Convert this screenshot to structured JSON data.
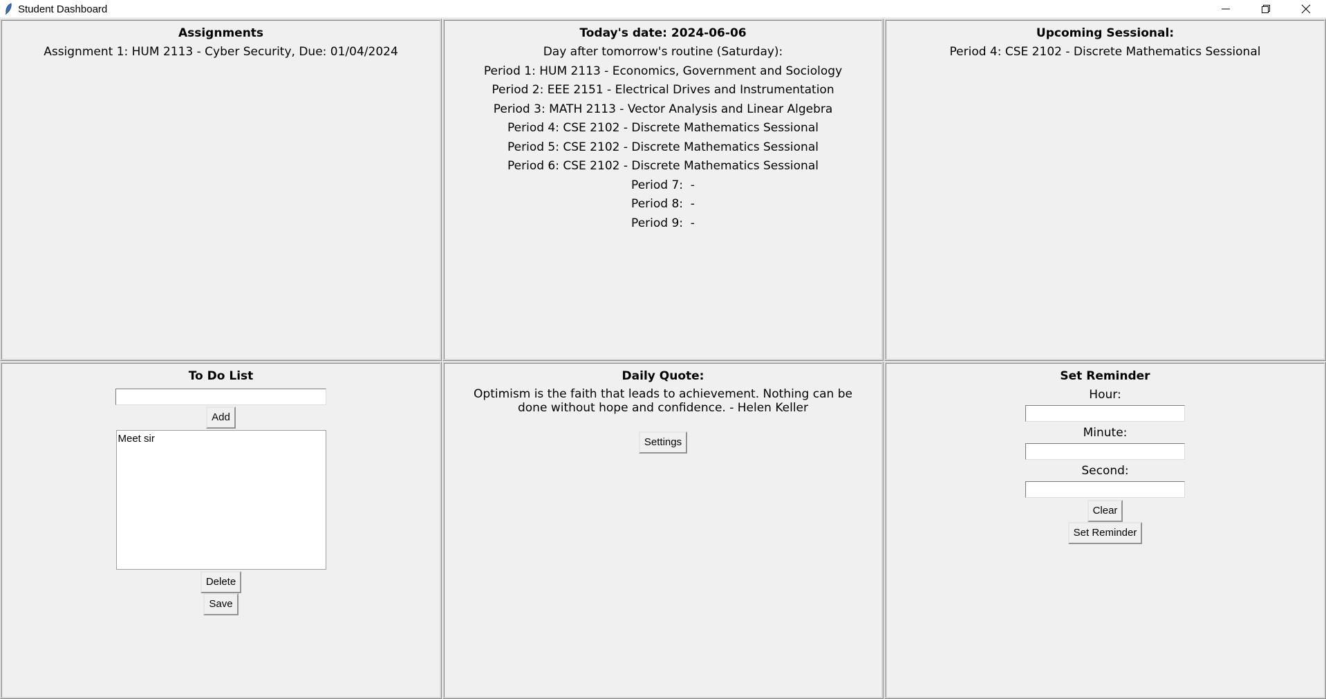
{
  "window": {
    "title": "Student Dashboard"
  },
  "assignments": {
    "heading": "Assignments",
    "items": [
      "Assignment 1: HUM 2113 - Cyber Security, Due: 01/04/2024"
    ]
  },
  "today": {
    "heading": "Today's date: 2024-06-06",
    "routine_label": "Day after tomorrow's routine (Saturday):",
    "periods": [
      "Period 1: HUM 2113 - Economics, Government and Sociology",
      "Period 2: EEE 2151 - Electrical Drives and Instrumentation",
      "Period 3: MATH 2113 - Vector Analysis and Linear Algebra",
      "Period 4: CSE 2102 - Discrete Mathematics Sessional",
      "Period 5: CSE 2102 - Discrete Mathematics Sessional",
      "Period 6: CSE 2102 - Discrete Mathematics Sessional",
      "Period 7:  -",
      "Period 8:  -",
      "Period 9:  -"
    ]
  },
  "upcoming": {
    "heading": "Upcoming Sessional:",
    "items": [
      "Period 4: CSE 2102 - Discrete Mathematics Sessional"
    ]
  },
  "todo": {
    "heading": "To Do List",
    "input_value": "",
    "add_label": "Add",
    "items": [
      "Meet sir"
    ],
    "delete_label": "Delete",
    "save_label": "Save"
  },
  "quote": {
    "heading": "Daily Quote:",
    "text": "Optimism is the faith that leads to achievement. Nothing can be done without hope and confidence. - Helen Keller",
    "settings_label": "Settings"
  },
  "reminder": {
    "heading": "Set Reminder",
    "hour_label": "Hour:",
    "minute_label": "Minute:",
    "second_label": "Second:",
    "hour_value": "",
    "minute_value": "",
    "second_value": "",
    "clear_label": "Clear",
    "set_label": "Set Reminder"
  }
}
